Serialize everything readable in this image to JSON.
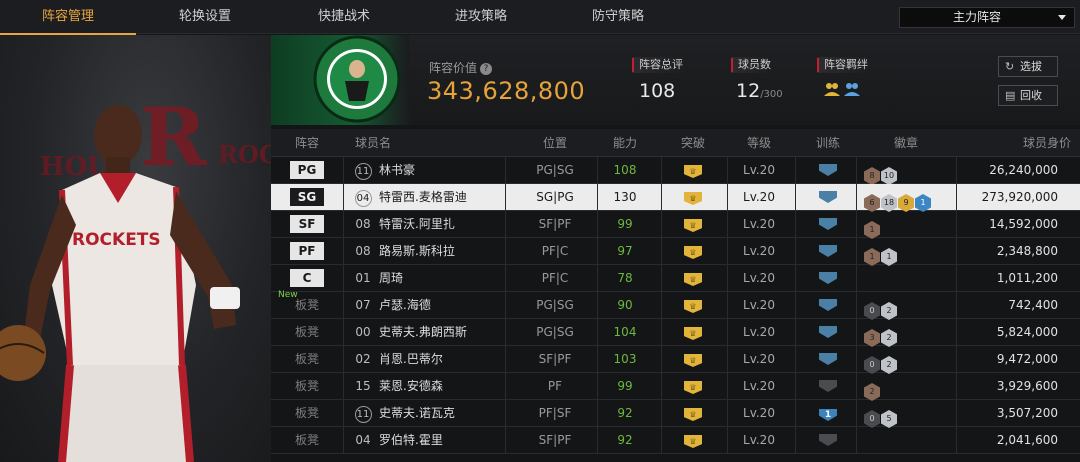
{
  "nav": {
    "tabs": [
      "阵容管理",
      "轮换设置",
      "快捷战术",
      "进攻策略",
      "防守策略"
    ],
    "active_index": 0,
    "lineup_select": "主力阵容"
  },
  "header": {
    "value_label": "阵容价值",
    "value": "343,628,800",
    "rating_label": "阵容总评",
    "rating": "108",
    "count_label": "球员数",
    "count": "12",
    "count_max": "/300",
    "bond_label": "阵容羁绊",
    "btn_select": "选拔",
    "btn_recycle": "回收"
  },
  "table": {
    "columns": [
      "阵容",
      "球员名",
      "位置",
      "能力",
      "突破",
      "等级",
      "训练",
      "徽章",
      "球员身价"
    ],
    "rows": [
      {
        "slot": "PG",
        "bench": false,
        "new": "",
        "num": "11",
        "circ": true,
        "name": "林书豪",
        "pos": "PG|SG",
        "ability": "108",
        "green": true,
        "level": "Lv.20",
        "train": "",
        "train_dim": false,
        "badges": [
          [
            "bronze",
            "8"
          ],
          [
            "silver",
            "10"
          ]
        ],
        "salary": "26,240,000"
      },
      {
        "slot": "SG",
        "bench": false,
        "new": "",
        "num": "04",
        "circ": true,
        "name": "特雷西.麦格雷迪",
        "pos": "SG|PG",
        "ability": "130",
        "green": false,
        "level": "Lv.20",
        "train": "",
        "train_dim": false,
        "badges": [
          [
            "bronze",
            "6"
          ],
          [
            "silver",
            "18"
          ],
          [
            "gold",
            "9"
          ],
          [
            "blue",
            "1"
          ]
        ],
        "salary": "273,920,000",
        "selected": true
      },
      {
        "slot": "SF",
        "bench": false,
        "new": "",
        "num": "08",
        "circ": false,
        "name": "特雷沃.阿里扎",
        "pos": "SF|PF",
        "ability": "99",
        "green": true,
        "level": "Lv.20",
        "train": "",
        "train_dim": false,
        "badges": [
          [
            "bronze",
            "1"
          ]
        ],
        "salary": "14,592,000"
      },
      {
        "slot": "PF",
        "bench": false,
        "new": "",
        "num": "08",
        "circ": false,
        "name": "路易斯.斯科拉",
        "pos": "PF|C",
        "ability": "97",
        "green": true,
        "level": "Lv.20",
        "train": "",
        "train_dim": false,
        "badges": [
          [
            "bronze",
            "1"
          ],
          [
            "silver",
            "1"
          ]
        ],
        "salary": "2,348,800"
      },
      {
        "slot": "C",
        "bench": false,
        "new": "",
        "num": "01",
        "circ": false,
        "name": "周琦",
        "pos": "PF|C",
        "ability": "78",
        "green": true,
        "level": "Lv.20",
        "train": "",
        "train_dim": false,
        "badges": [],
        "salary": "1,011,200"
      },
      {
        "slot": "板凳",
        "bench": true,
        "new": "New",
        "num": "07",
        "circ": false,
        "name": "卢瑟.海德",
        "pos": "PG|SG",
        "ability": "90",
        "green": true,
        "level": "Lv.20",
        "train": "",
        "train_dim": false,
        "badges": [
          [
            "dark",
            "0"
          ],
          [
            "silver",
            "2"
          ]
        ],
        "salary": "742,400"
      },
      {
        "slot": "板凳",
        "bench": true,
        "new": "",
        "num": "00",
        "circ": false,
        "name": "史蒂夫.弗朗西斯",
        "pos": "PG|SG",
        "ability": "104",
        "green": true,
        "level": "Lv.20",
        "train": "",
        "train_dim": false,
        "badges": [
          [
            "bronze",
            "3"
          ],
          [
            "silver",
            "2"
          ]
        ],
        "salary": "5,824,000"
      },
      {
        "slot": "板凳",
        "bench": true,
        "new": "",
        "num": "02",
        "circ": false,
        "name": "肖恩.巴蒂尔",
        "pos": "SF|PF",
        "ability": "103",
        "green": true,
        "level": "Lv.20",
        "train": "",
        "train_dim": false,
        "badges": [
          [
            "dark",
            "0"
          ],
          [
            "silver",
            "2"
          ]
        ],
        "salary": "9,472,000"
      },
      {
        "slot": "板凳",
        "bench": true,
        "new": "",
        "num": "15",
        "circ": false,
        "name": "莱恩.安德森",
        "pos": "PF",
        "ability": "99",
        "green": true,
        "level": "Lv.20",
        "train": "",
        "train_dim": true,
        "badges": [
          [
            "bronze",
            "2"
          ]
        ],
        "salary": "3,929,600"
      },
      {
        "slot": "板凳",
        "bench": true,
        "new": "",
        "num": "11",
        "circ": true,
        "name": "史蒂夫.诺瓦克",
        "pos": "PF|SF",
        "ability": "92",
        "green": true,
        "level": "Lv.20",
        "train": "1",
        "train_dim": false,
        "badges": [
          [
            "dark",
            "0"
          ],
          [
            "silver",
            "5"
          ]
        ],
        "salary": "3,507,200"
      },
      {
        "slot": "板凳",
        "bench": true,
        "new": "",
        "num": "04",
        "circ": false,
        "name": "罗伯特.霍里",
        "pos": "SF|PF",
        "ability": "92",
        "green": true,
        "level": "Lv.20",
        "train": "",
        "train_dim": true,
        "badges": [],
        "salary": "2,041,600"
      }
    ]
  },
  "colors": {
    "accent": "#e9a640",
    "value": "#e6a33a",
    "green": "#6fb83f",
    "red_marker": "#c3202b",
    "team_green": "#155a32"
  }
}
